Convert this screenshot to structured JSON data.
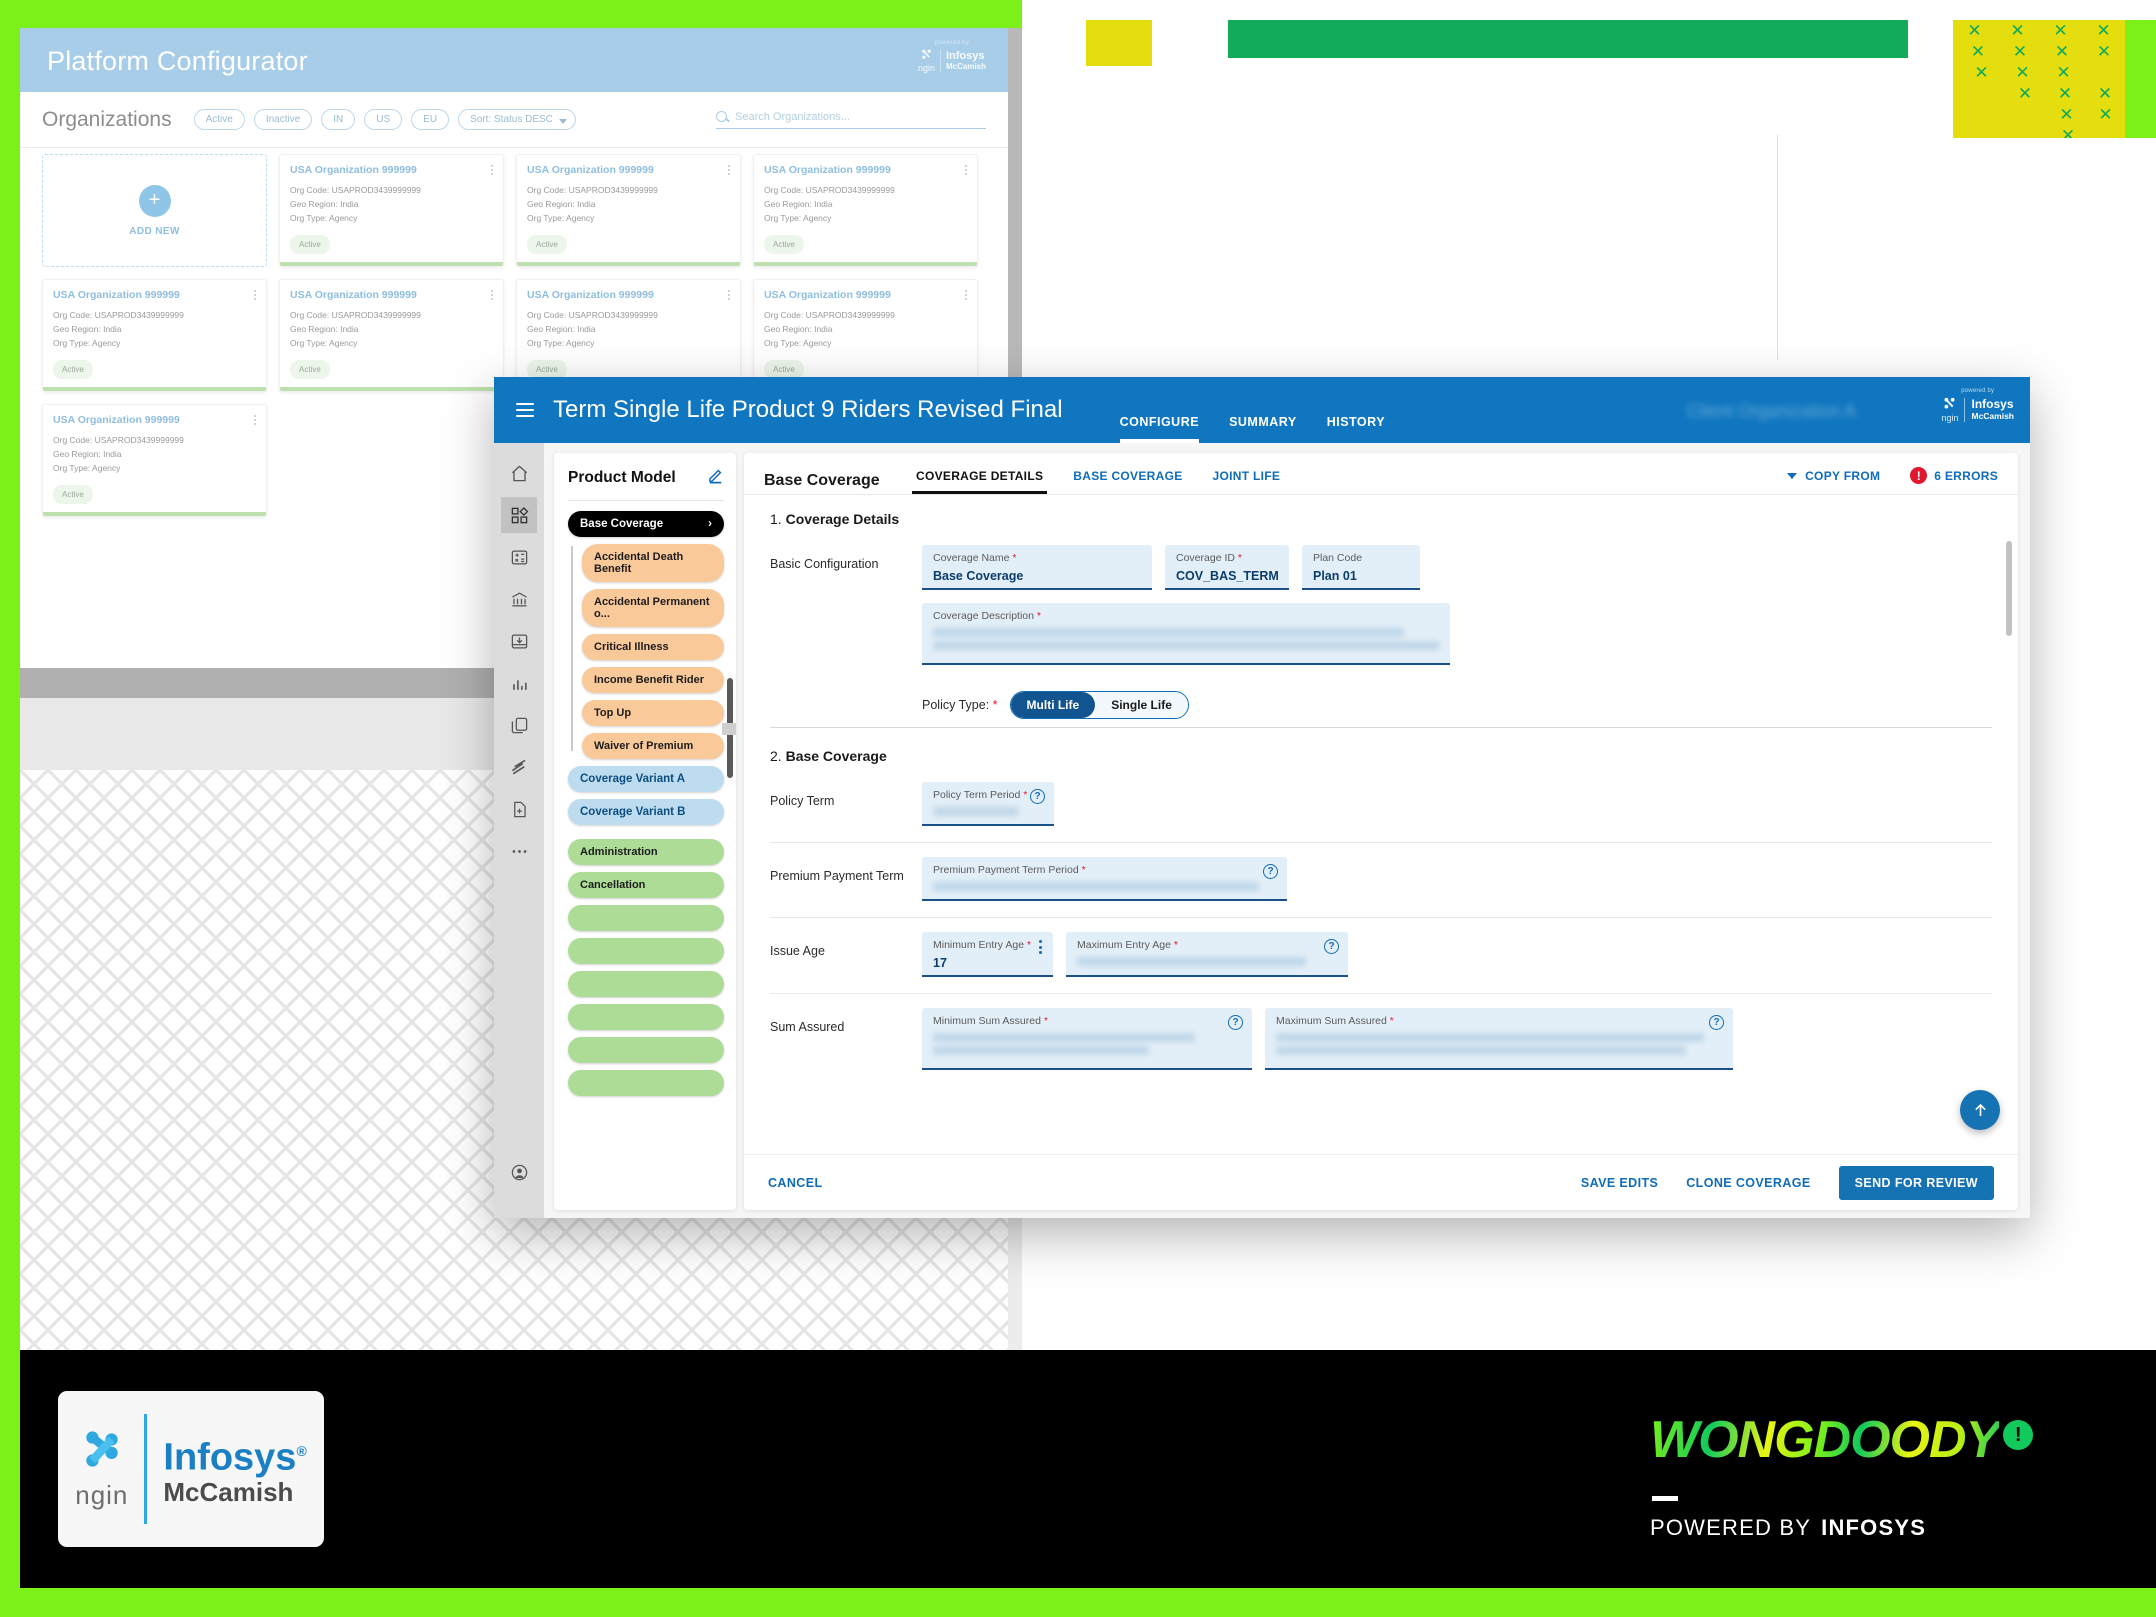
{
  "theme": {
    "brand_green": "#7CF019",
    "accent_blue": "#0F76BF",
    "error_red": "#E0182D",
    "yellow": "#E4DE0E",
    "green_block": "#12AB5B"
  },
  "background_app": {
    "title": "Platform Configurator",
    "logo": {
      "powered_by": "powered by",
      "ngin": "ngin",
      "infosys": "Infosys",
      "mccamish": "McCamish"
    },
    "section_title": "Organizations",
    "filters": [
      "Active",
      "Inactive",
      "IN",
      "US",
      "EU"
    ],
    "sort_label": "Sort: Status DESC",
    "search_placeholder": "Search Organizations...",
    "add_new_label": "ADD NEW",
    "card_fields": {
      "name": "USA Organization 999999",
      "org_code": "Org Code: USAPROD3439999999",
      "geo_region": "Geo Region: India",
      "org_type": "Org Type: Agency",
      "status": "Active"
    },
    "cards_count": 8
  },
  "modal": {
    "title": "Term Single Life Product 9 Riders Revised Final",
    "tabs": [
      {
        "label": "CONFIGURE",
        "active": true
      },
      {
        "label": "SUMMARY",
        "active": false
      },
      {
        "label": "HISTORY",
        "active": false
      }
    ],
    "org_ghost_text": "Client Organization A",
    "logo": {
      "powered_by": "powered by",
      "ngin": "ngin",
      "infosys": "Infosys",
      "mccamish": "McCamish"
    },
    "rail_icons": [
      "home-icon",
      "dashboard-icon",
      "calculator-icon",
      "bank-icon",
      "inbox-download-icon",
      "bar-chart-icon",
      "copy-icon",
      "layers-icon",
      "new-document-icon",
      "more-icon"
    ],
    "rail_selected_index": 1,
    "rail_avatar_icon": "account-icon",
    "product_model": {
      "title": "Product Model",
      "edit_icon": "pencil-icon",
      "root": {
        "label": "Base Coverage",
        "chevron": "chevron-right-icon"
      },
      "children": [
        "Accidental Death Benefit",
        "Accidental Permanent o...",
        "Critical Illness",
        "Income Benefit Rider",
        "Top Up",
        "Waiver of Premium"
      ],
      "variants": [
        "Coverage Variant A",
        "Coverage Variant B"
      ],
      "groups": [
        "Administration",
        "Cancellation"
      ],
      "blank_groups": 6
    },
    "content": {
      "header_title": "Base Coverage",
      "tabs": [
        {
          "label": "COVERAGE DETAILS",
          "active": true
        },
        {
          "label": "BASE COVERAGE",
          "active": false
        },
        {
          "label": "JOINT LIFE",
          "active": false
        }
      ],
      "copy_from_label": "COPY FROM",
      "errors_label": "6 ERRORS",
      "errors_icon": "error-circle-icon",
      "section1": {
        "number": "1.",
        "title": "Coverage Details",
        "row_label": "Basic Configuration",
        "fields": [
          {
            "label": "Coverage Name",
            "required": true,
            "value": "Base Coverage"
          },
          {
            "label": "Coverage ID",
            "required": true,
            "value": "COV_BAS_TERM"
          },
          {
            "label": "Plan Code",
            "required": false,
            "value": "Plan 01"
          },
          {
            "label": "Coverage Description",
            "required": true,
            "value": ""
          }
        ],
        "policy_type": {
          "label": "Policy Type:",
          "required": true,
          "options": [
            "Multi Life",
            "Single Life"
          ],
          "selected": "Multi Life"
        }
      },
      "section2": {
        "number": "2.",
        "title": "Base Coverage",
        "rows": [
          {
            "label": "Policy Term",
            "fields": [
              {
                "label": "Policy Term Period",
                "required": true,
                "value": "",
                "help": true
              }
            ]
          },
          {
            "label": "Premium Payment Term",
            "fields": [
              {
                "label": "Premium Payment Term Period",
                "required": true,
                "value": "",
                "help": true
              }
            ]
          },
          {
            "label": "Issue Age",
            "fields": [
              {
                "label": "Minimum Entry Age",
                "required": true,
                "value": "17",
                "menu": true
              },
              {
                "label": "Maximum Entry Age",
                "required": true,
                "value": "",
                "help": true
              }
            ]
          },
          {
            "label": "Sum Assured",
            "fields": [
              {
                "label": "Minimum Sum Assured",
                "required": true,
                "value": "",
                "help": true
              },
              {
                "label": "Maximum Sum Assured",
                "required": true,
                "value": "",
                "help": true
              }
            ]
          }
        ]
      },
      "scroll_top_icon": "arrow-up-icon",
      "footer": {
        "cancel_label": "CANCEL",
        "save_label": "SAVE EDITS",
        "clone_label": "CLONE COVERAGE",
        "send_label": "SEND FOR REVIEW"
      }
    }
  },
  "footer": {
    "ngin_logo": {
      "ngin": "ngin",
      "infosys": "Infosys",
      "mccamish": "McCamish"
    },
    "agency": {
      "name": "WONGDOODY",
      "bang": "!",
      "powered_by": "POWERED BY",
      "parent": "INFOSYS"
    }
  }
}
